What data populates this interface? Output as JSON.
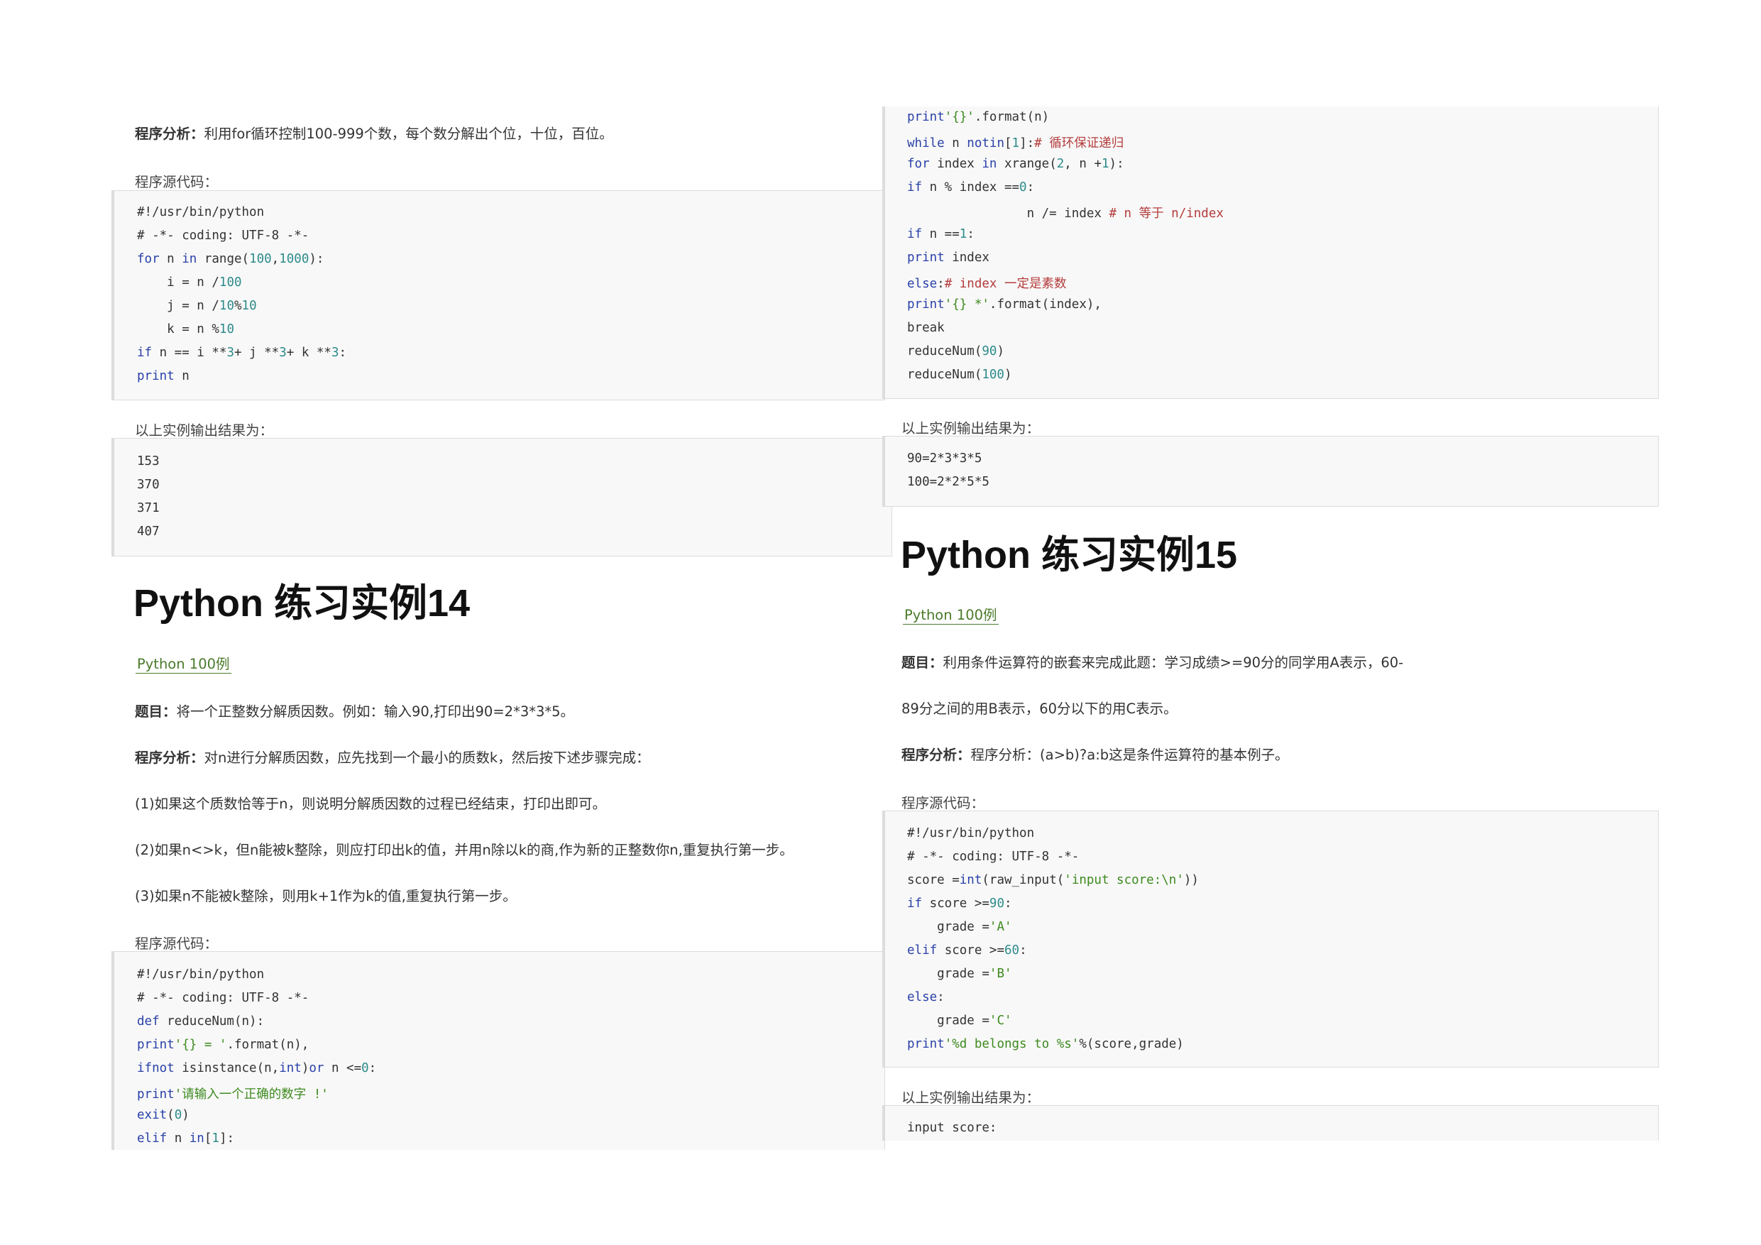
{
  "left": {
    "analysis13": {
      "label": "程序分析：",
      "text": "利用for循环控制100-999个数，每个数分解出个位，十位，百位。"
    },
    "source_label_1": "程序源代码：",
    "code1": [
      "#!/usr/bin/python",
      "# -*- coding: UTF-8 -*-",
      "for n in range(100,1000):",
      "    i = n /100",
      "    j = n /10%10",
      "    k = n %10",
      "if n == i **3+ j **3+ k **3:",
      "print n"
    ],
    "output_label_1": "以上实例输出结果为：",
    "output1": [
      "153",
      "370",
      "371",
      "407"
    ],
    "title14": "Python 练习实例14",
    "link14": "Python 100例",
    "question14": {
      "label": "题目：",
      "text": "将一个正整数分解质因数。例如：输入90,打印出90=2*3*3*5。"
    },
    "analysis14": {
      "label": "程序分析：",
      "text": "对n进行分解质因数，应先找到一个最小的质数k，然后按下述步骤完成："
    },
    "step1": "(1)如果这个质数恰等于n，则说明分解质因数的过程已经结束，打印出即可。",
    "step2": "(2)如果n<>k，但n能被k整除，则应打印出k的值，并用n除以k的商,作为新的正整数你n,重复执行第一步。",
    "step3": "(3)如果n不能被k整除，则用k+1作为k的值,重复执行第一步。",
    "source_label_2": "程序源代码：",
    "code2": [
      "#!/usr/bin/python",
      "# -*- coding: UTF-8 -*-",
      "def reduceNum(n):",
      "print'{} = '.format(n),",
      "ifnot isinstance(n,int)or n <=0:",
      "print'请输入一个正确的数字 !'",
      "exit(0)",
      "elif n in[1]:"
    ]
  },
  "right": {
    "code3": [
      "print'{}'.format(n)",
      "while n notin[1]:# 循环保证递归",
      "for index in xrange(2, n +1):",
      "if n % index ==0:",
      "                n /= index # n 等于 n/index",
      "if n ==1:",
      "print index",
      "else:# index 一定是素数",
      "print'{} *'.format(index),",
      "break",
      "reduceNum(90)",
      "reduceNum(100)"
    ],
    "output_label_3": "以上实例输出结果为：",
    "output3": [
      "90=2*3*3*5",
      "100=2*2*5*5"
    ],
    "title15": "Python 练习实例15",
    "link15": "Python 100例",
    "question15": {
      "label": "题目：",
      "text": "利用条件运算符的嵌套来完成此题：学习成绩>=90分的同学用A表示，60-"
    },
    "question15b": "89分之间的用B表示，60分以下的用C表示。",
    "analysis15": {
      "label": "程序分析：",
      "text": "程序分析：(a>b)?a:b这是条件运算符的基本例子。"
    },
    "source_label_4": "程序源代码：",
    "code4": [
      "#!/usr/bin/python",
      "# -*- coding: UTF-8 -*-",
      "score =int(raw_input('input score:\\n'))",
      "if score >=90:",
      "    grade ='A'",
      "elif score >=60:",
      "    grade ='B'",
      "else:",
      "    grade ='C'",
      "print'%d belongs to %s'%(score,grade)"
    ],
    "output_label_4": "以上实例输出结果为：",
    "output4": [
      "input score:"
    ]
  }
}
